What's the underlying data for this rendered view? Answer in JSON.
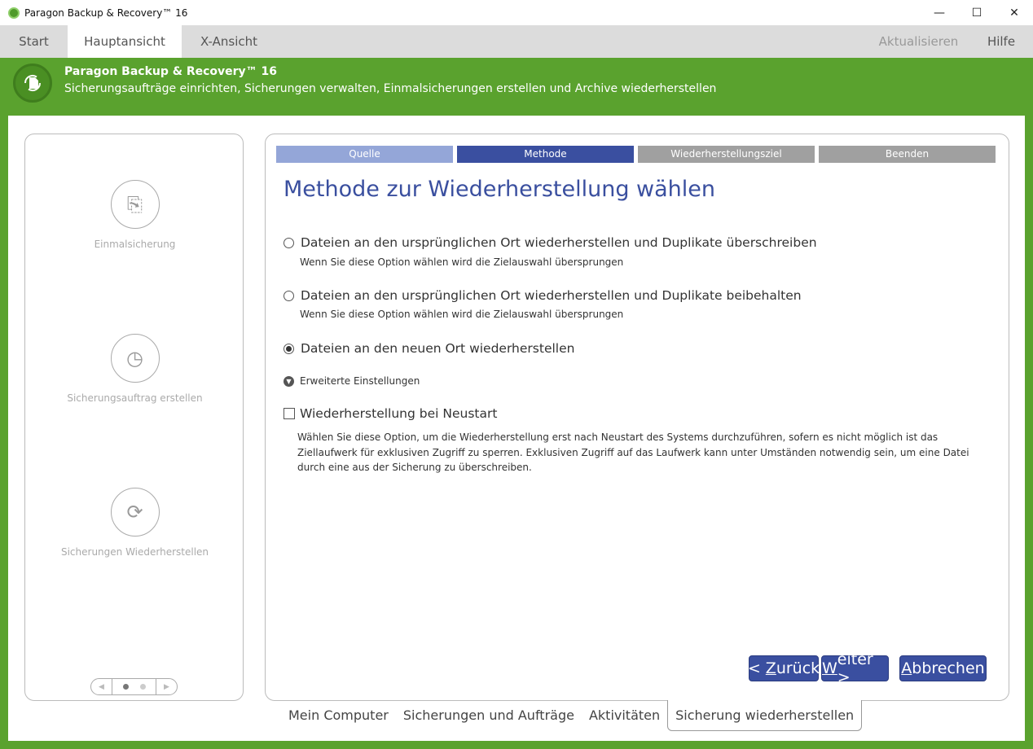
{
  "window": {
    "title": "Paragon Backup & Recovery™ 16",
    "minimize": "—",
    "maximize": "☐",
    "close": "✕"
  },
  "tabs": [
    {
      "label": "Start"
    },
    {
      "label": "Hauptansicht"
    },
    {
      "label": "X-Ansicht"
    }
  ],
  "top_actions": {
    "update": "Aktualisieren",
    "help": "Hilfe"
  },
  "header": {
    "title": "Paragon Backup & Recovery™ 16",
    "subtitle": "Sicherungsaufträge einrichten, Sicherungen verwalten, Einmalsicherungen erstellen und Archive wiederherstellen"
  },
  "sidebar": {
    "items": [
      {
        "label": "Einmalsicherung"
      },
      {
        "label": "Sicherungsauftrag erstellen"
      },
      {
        "label": "Sicherungen Wiederherstellen"
      }
    ]
  },
  "wizard": {
    "steps": [
      {
        "label": "Quelle",
        "color": "#94a6d8"
      },
      {
        "label": "Methode",
        "color": "#3a4fa0"
      },
      {
        "label": "Wiederherstellungsziel",
        "color": "#a0a0a0"
      },
      {
        "label": "Beenden",
        "color": "#a0a0a0"
      }
    ],
    "title": "Methode zur Wiederherstellung wählen",
    "options": [
      {
        "label": "Dateien an den ursprünglichen Ort wiederherstellen und Duplikate überschreiben",
        "hint": "Wenn Sie diese Option wählen wird die Zielauswahl übersprungen",
        "selected": false
      },
      {
        "label": "Dateien an den ursprünglichen Ort wiederherstellen und Duplikate beibehalten",
        "hint": "Wenn Sie diese Option wählen wird die Zielauswahl übersprungen",
        "selected": false
      },
      {
        "label": "Dateien an den neuen Ort wiederherstellen",
        "selected": true
      }
    ],
    "advanced": "Erweiterte Einstellungen",
    "reboot_label": "Wiederherstellung bei Neustart",
    "reboot_desc": "Wählen Sie diese Option, um die Wiederherstellung erst nach Neustart des Systems durchzuführen, sofern es nicht möglich ist das Ziellaufwerk für exklusiven Zugriff zu sperren. Exklusiven Zugriff auf das Laufwerk kann unter Umständen notwendig sein, um eine Datei durch eine aus der Sicherung zu überschreiben.",
    "buttons": {
      "back_prefix": "< ",
      "back_key": "Z",
      "back_rest": "urück",
      "next_key": "W",
      "next_rest": "eiter >",
      "cancel_key": "A",
      "cancel_rest": "bbrechen"
    }
  },
  "bottom_tabs": [
    {
      "label": "Mein Computer"
    },
    {
      "label": "Sicherungen und Aufträge"
    },
    {
      "label": "Aktivitäten"
    },
    {
      "label": "Sicherung wiederherstellen"
    }
  ]
}
